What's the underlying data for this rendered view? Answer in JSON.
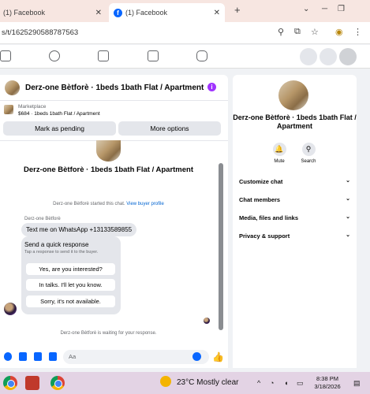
{
  "browser": {
    "tabs": [
      {
        "label": "(1) Facebook",
        "close": "✕"
      },
      {
        "label": "(1) Facebook",
        "close": "✕"
      }
    ],
    "new_tab": "+",
    "url": "s/t/1625290588787563",
    "window_controls": [
      "⌄",
      "─",
      "❐"
    ]
  },
  "chat": {
    "header_title": "Derz-one Bètforè · 1beds 1bath Flat / Apartment",
    "marketplace_label": "Marketplace",
    "listing_line": "$684 · 1beds 1bath Flat / Apartment",
    "buttons": {
      "mark_pending": "Mark as pending",
      "more_options": "More options"
    },
    "center_title": "Derz-one Bètforè · 1beds 1bath Flat / Apartment",
    "system_message": "Derz-one Bètforè started this chat.",
    "system_link": "View buyer profile",
    "sender_name": "Derz-one Bètforè",
    "message": "Text me on WhatsApp +13133589855",
    "quick_reply": {
      "title": "Send a quick response",
      "subtitle": "Tap a response to send it to the buyer.",
      "options": [
        "Yes, are you interested?",
        "In talks. I'll let you know.",
        "Sorry, it's not available."
      ]
    },
    "waiting": "Derz-one Bètforè is waiting for your response.",
    "input_placeholder": "Aa"
  },
  "info_panel": {
    "title": "Derz-one Bètforè · 1beds 1bath Flat / Apartment",
    "actions": [
      {
        "label": "Mute",
        "icon": "bell-icon"
      },
      {
        "label": "Search",
        "icon": "search-icon"
      }
    ],
    "rows": [
      "Customize chat",
      "Chat members",
      "Media, files and links",
      "Privacy & support"
    ]
  },
  "taskbar": {
    "weather": "23°C  Mostly clear",
    "time": "8:38 PM",
    "date": "3/18/2026",
    "tray_chevron": "^"
  },
  "colors": {
    "accent": "#0866ff",
    "info": "#a033ff",
    "tab_bar": "#f7e6e1",
    "taskbar": "#e3d3e4"
  }
}
